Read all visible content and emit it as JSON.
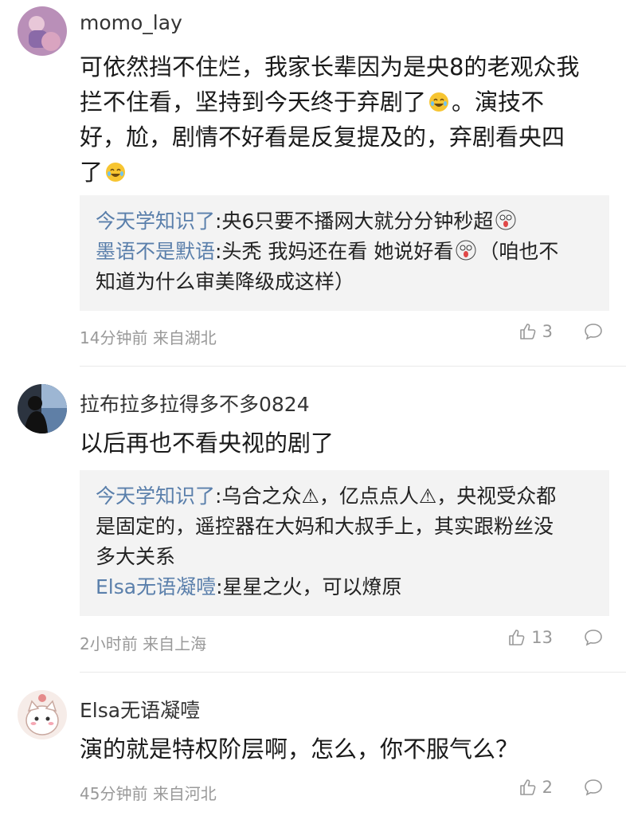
{
  "colors": {
    "username": "#333333",
    "reply_name": "#5a7fab",
    "meta": "#999999",
    "reply_bg": "#f3f3f3"
  },
  "comments": [
    {
      "username": "momo_lay",
      "content_lines": [
        "可依然挡不住烂，我家长辈因为是央8的老观众我",
        "拦不住看，坚持到今天终于弃剧了",
        "。演技不",
        "好，尬，剧情不好看是反复提及的，弃剧看央四",
        "了"
      ],
      "replies": [
        {
          "name": "今天学知识了",
          "text": ":央6只要不播网大就分分钟秒超"
        },
        {
          "name": "墨语不是默语",
          "text": ":头秃 我妈还在看 她说好看",
          "text2": "（咱也不",
          "text3": "知道为什么审美降级成这样）"
        }
      ],
      "time": "14分钟前",
      "location": "来自湖北",
      "likes": "3"
    },
    {
      "username": "拉布拉多拉得多不多0824",
      "content_lines": [
        "以后再也不看央视的剧了"
      ],
      "replies": [
        {
          "name": "今天学知识了",
          "text": ":乌合之众⚠，亿点点人⚠，央视受众都",
          "text2": "是固定的，遥控器在大妈和大叔手上，其实跟粉丝没",
          "text3": "多大关系"
        },
        {
          "name": "Elsa无语凝噎",
          "text": ":星星之火，可以燎原"
        }
      ],
      "time": "2小时前",
      "location": "来自上海",
      "likes": "13"
    },
    {
      "username": "Elsa无语凝噎",
      "content_lines": [
        "演的就是特权阶层啊，怎么，你不服气么？"
      ],
      "time": "45分钟前",
      "location": "来自河北",
      "likes": "2"
    }
  ]
}
